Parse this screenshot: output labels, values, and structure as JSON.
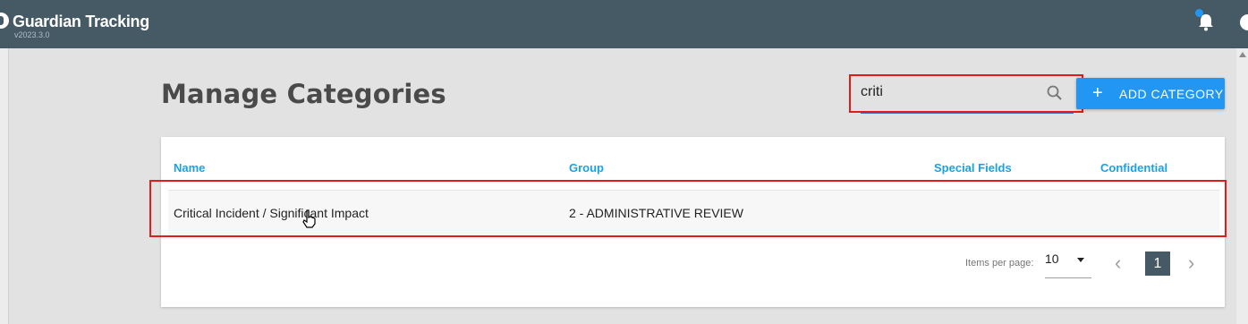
{
  "header": {
    "app_title": "Guardian Tracking",
    "version": "v2023.3.0",
    "icons": [
      "notification-bell-icon",
      "user-account-icon"
    ]
  },
  "page": {
    "title": "Manage Categories"
  },
  "search": {
    "value": "criti",
    "placeholder": "",
    "icon": "search-icon"
  },
  "add_button": {
    "icon": "+",
    "label": "ADD CATEGORY"
  },
  "table": {
    "columns": [
      "Name",
      "Group",
      "Special Fields",
      "Confidential"
    ],
    "rows": [
      {
        "name": "Critical Incident / Significant Impact",
        "group": "2 - ADMINISTRATIVE REVIEW",
        "special_fields": "",
        "confidential": ""
      }
    ]
  },
  "paginator": {
    "items_per_page_label": "Items per page:",
    "items_per_page": "10",
    "current_page": "1",
    "prev_icon": "‹",
    "next_icon": "›"
  },
  "colors": {
    "header_bg": "#455a64",
    "accent": "#2196f3",
    "column_header": "#1ba1e2",
    "highlight": "#e41b1b"
  }
}
